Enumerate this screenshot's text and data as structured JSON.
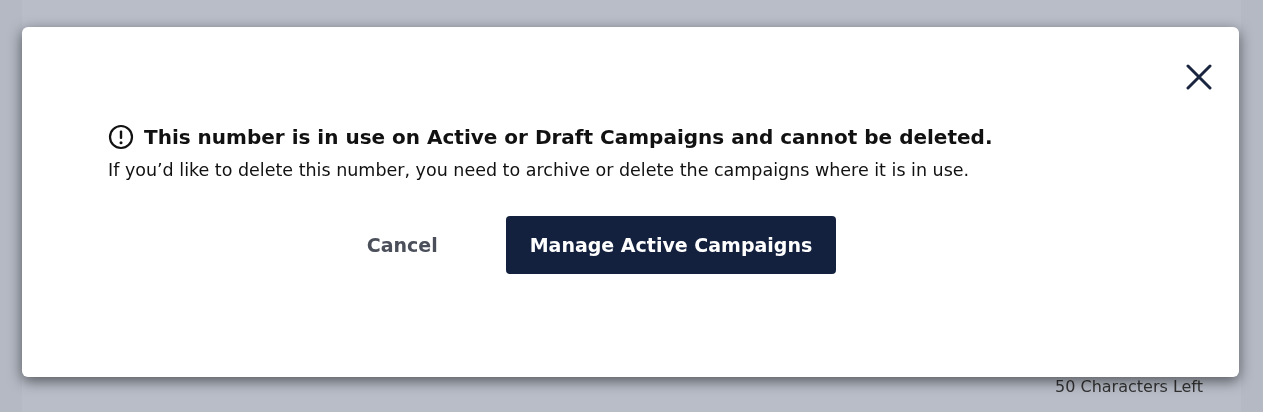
{
  "background": {
    "counter": "50 Characters Left"
  },
  "dialog": {
    "title": "This number is in use on Active or Draft Campaigns and cannot be deleted.",
    "message": "If you’d like to delete this number, you need to archive or delete the campaigns where it is in use.",
    "buttons": [
      {
        "label": "Cancel",
        "kind": "secondary"
      },
      {
        "label": "Manage Active Campaigns",
        "kind": "primary"
      }
    ]
  }
}
